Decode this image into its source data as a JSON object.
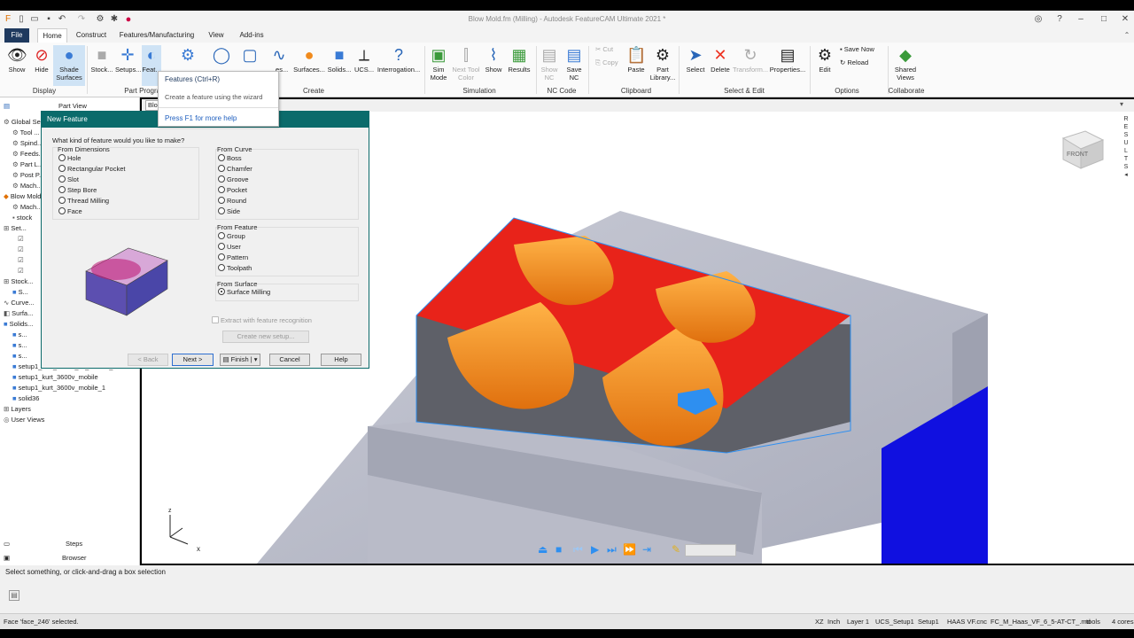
{
  "window": {
    "title": "Blow Mold.fm (Milling) - Autodesk FeatureCAM Ultimate 2021 *"
  },
  "menu": {
    "file": "File",
    "tabs": [
      "Home",
      "Construct",
      "Features/Manufacturing",
      "View",
      "Add-ins"
    ]
  },
  "ribbon": {
    "show": "Show",
    "hide": "Hide",
    "shade": "Shade Surfaces",
    "stock": "Stock...",
    "setups": "Setups...",
    "features": "Feat...",
    "lines": "...es...",
    "surfaces": "Surfaces...",
    "solids": "Solids...",
    "ucs": "UCS...",
    "interrogation": "Interrogation...",
    "sim_mode": "Sim Mode",
    "next_tool_color": "Next Tool Color",
    "sim_show": "Show",
    "results": "Results",
    "show_nc": "Show NC",
    "save_nc": "Save NC",
    "cut": "Cut",
    "copy": "Copy",
    "paste": "Paste",
    "part_library": "Part Library...",
    "select": "Select",
    "delete": "Delete",
    "transform": "Transform...",
    "properties": "Properties...",
    "edit": "Edit",
    "save_now": "Save Now",
    "reload": "Reload",
    "shared_views": "Shared Views",
    "groups": {
      "display": "Display",
      "part_program": "Part Program",
      "create": "Create",
      "simulation": "Simulation",
      "nc_code": "NC Code",
      "clipboard": "Clipboard",
      "select_edit": "Select & Edit",
      "options": "Options",
      "collaborate": "Collaborate"
    }
  },
  "tooltip": {
    "title": "Features (Ctrl+R)",
    "description": "Create a feature using the wizard",
    "help": "Press F1 for more help"
  },
  "panel": {
    "header": "Part View",
    "tree": [
      "Global Se...",
      "Tool ...",
      "Spind...",
      "Feeds...",
      "Part L...",
      "Post P...",
      "Mach...",
      "Blow Mold...",
      "Mach...",
      "stock",
      "Set...",
      "",
      "",
      "",
      "",
      "Stock...",
      "S...",
      "Curve...",
      "Surfa...",
      "Solids...",
      "s...",
      "s...",
      "s...",
      "setup1_kurt_3600v_fix_bottom_2",
      "setup1_kurt_3600v_mobile",
      "setup1_kurt_3600v_mobile_1",
      "solid36",
      "Layers",
      "User Views"
    ],
    "steps": "Steps",
    "browser": "Browser"
  },
  "viewport": {
    "tab": "Blo...",
    "cube_label": "FRONT"
  },
  "dialog": {
    "title": "New Feature",
    "question": "What kind of feature would you like to make?",
    "from_dimensions": "From Dimensions",
    "dimension_options": [
      "Hole",
      "Rectangular Pocket",
      "Slot",
      "Step Bore",
      "Thread Milling",
      "Face"
    ],
    "from_curve": "From Curve",
    "curve_options": [
      "Boss",
      "Chamfer",
      "Groove",
      "Pocket",
      "Round",
      "Side"
    ],
    "from_feature": "From Feature",
    "feature_options": [
      "Group",
      "User",
      "Pattern",
      "Toolpath"
    ],
    "from_surface": "From Surface",
    "surface_option": "Surface Milling",
    "extract": "Extract with feature recognition",
    "create_setup": "Create new setup...",
    "back": "< Back",
    "next": "Next >",
    "finish": "Finish",
    "cancel": "Cancel",
    "help": "Help"
  },
  "status": {
    "prompt": "Select something, or click-and-drag a box selection",
    "selected": "Face 'face_246' selected.",
    "right": [
      "XZ",
      "Inch",
      "Layer 1",
      "UCS_Setup1",
      "Setup1",
      "HAAS VF.cnc",
      "FC_M_Haas_VF_6_5-AT-CT_.md",
      "tools",
      "4 cores"
    ]
  },
  "colors": {
    "accent": "#0b6b6b",
    "part_orange": "#f08a1c",
    "part_red": "#e8231a",
    "selection_blue": "#2e8ff0"
  }
}
